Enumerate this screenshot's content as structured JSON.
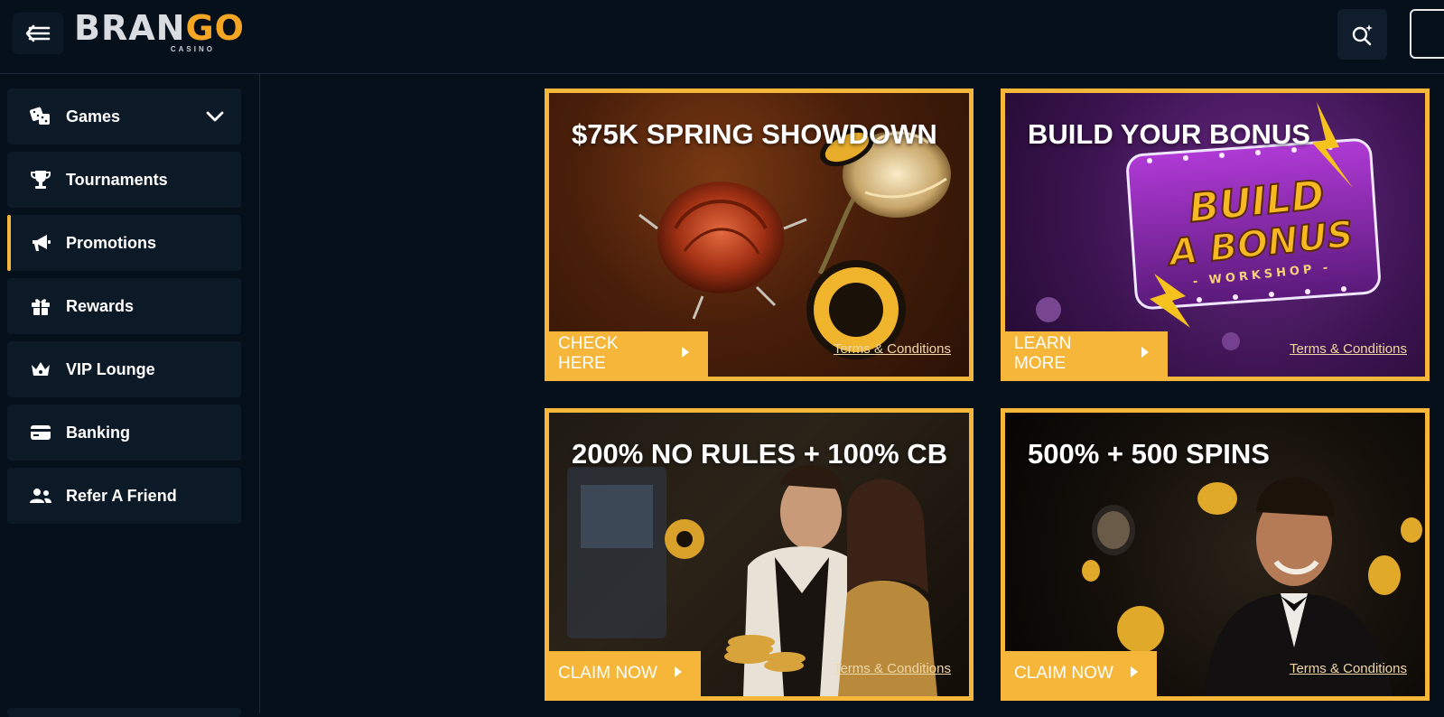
{
  "brand": {
    "logo_main_a": "BRAN",
    "logo_main_b": "GO",
    "logo_sub": "CASINO"
  },
  "sidebar": {
    "items": [
      {
        "label": "Games",
        "icon": "dice-icon"
      },
      {
        "label": "Tournaments",
        "icon": "trophy-icon"
      },
      {
        "label": "Promotions",
        "icon": "megaphone-icon"
      },
      {
        "label": "Rewards",
        "icon": "gift-icon"
      },
      {
        "label": "VIP Lounge",
        "icon": "crown-icon"
      },
      {
        "label": "Banking",
        "icon": "card-icon"
      },
      {
        "label": "Refer A Friend",
        "icon": "users-icon"
      }
    ],
    "active": "Promotions"
  },
  "promos": [
    {
      "title": "$75K SPRING SHOWDOWN",
      "cta": "CHECK HERE",
      "terms": "Terms & Conditions"
    },
    {
      "title": "BUILD YOUR BONUS",
      "cta": "LEARN MORE",
      "terms": "Terms & Conditions",
      "art_line1": "BUILD",
      "art_line2": "A BONUS",
      "art_line3": "- WORKSHOP -"
    },
    {
      "title": "200% NO RULES + 100% CB",
      "cta": "CLAIM NOW",
      "terms": "Terms & Conditions"
    },
    {
      "title": "500% + 500 SPINS",
      "cta": "CLAIM NOW",
      "terms": "Terms & Conditions"
    }
  ],
  "colors": {
    "accent": "#f5b639",
    "background": "#06101b",
    "nav_bg": "#0c1a28"
  }
}
